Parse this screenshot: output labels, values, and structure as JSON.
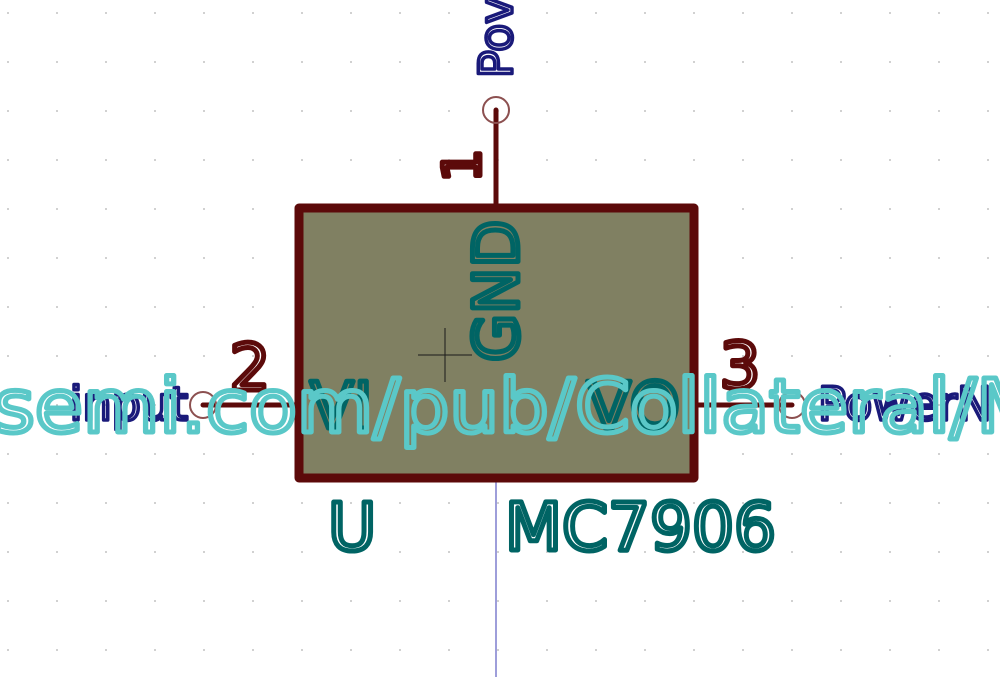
{
  "schematic": {
    "component": {
      "reference": "U",
      "value": "MC7906",
      "fill_color": "#808062",
      "outline_color": "#5c0a0a"
    },
    "pins": {
      "gnd": {
        "number": "1",
        "name": "GND"
      },
      "input": {
        "number": "2",
        "name": "VI"
      },
      "output": {
        "number": "3",
        "name": "VO"
      }
    },
    "net_labels": {
      "top": "Pov",
      "left": "input",
      "right": "PowerN"
    },
    "overlay_text": "semi.com/pub/Collateral/M",
    "colors": {
      "pin_wire": "#5c0a0a",
      "pin_label": "#5c0a0a",
      "pin_name": "#006464",
      "field_text": "#006464",
      "net_label": "#1a1a7a",
      "overlay": "#5ac8c8",
      "axis": "#3c3cb4",
      "connection_circle": "#8c5050",
      "grid_dot": "#b0b0b0"
    }
  }
}
